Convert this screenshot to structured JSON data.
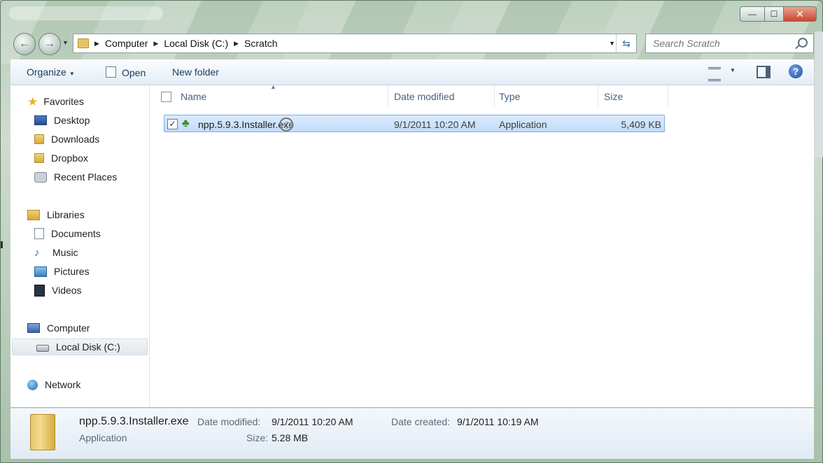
{
  "window": {
    "minimize_glyph": "—",
    "maximize_glyph": "☐",
    "close_glyph": "✕"
  },
  "address_bar": {
    "breadcrumbs": [
      "Computer",
      "Local Disk (C:)",
      "Scratch"
    ]
  },
  "search": {
    "placeholder": "Search Scratch"
  },
  "toolbar": {
    "organize_label": "Organize",
    "open_label": "Open",
    "new_folder_label": "New folder"
  },
  "sidebar": {
    "favorites": {
      "label": "Favorites",
      "items": [
        "Desktop",
        "Downloads",
        "Dropbox",
        "Recent Places"
      ]
    },
    "libraries": {
      "label": "Libraries",
      "items": [
        "Documents",
        "Music",
        "Pictures",
        "Videos"
      ]
    },
    "computer": {
      "label": "Computer",
      "items": [
        "Local Disk (C:)"
      ]
    },
    "network": {
      "label": "Network"
    }
  },
  "columns": {
    "name": "Name",
    "date": "Date modified",
    "type": "Type",
    "size": "Size"
  },
  "files": [
    {
      "name": "npp.5.9.3.Installer.exe",
      "date": "9/1/2011 10:20 AM",
      "type": "Application",
      "size": "5,409 KB",
      "checked": true
    }
  ],
  "details": {
    "name": "npp.5.9.3.Installer.exe",
    "type": "Application",
    "date_modified_label": "Date modified:",
    "date_modified": "9/1/2011 10:20 AM",
    "size_label": "Size:",
    "size": "5.28 MB",
    "date_created_label": "Date created:",
    "date_created": "9/1/2011 10:19 AM"
  }
}
